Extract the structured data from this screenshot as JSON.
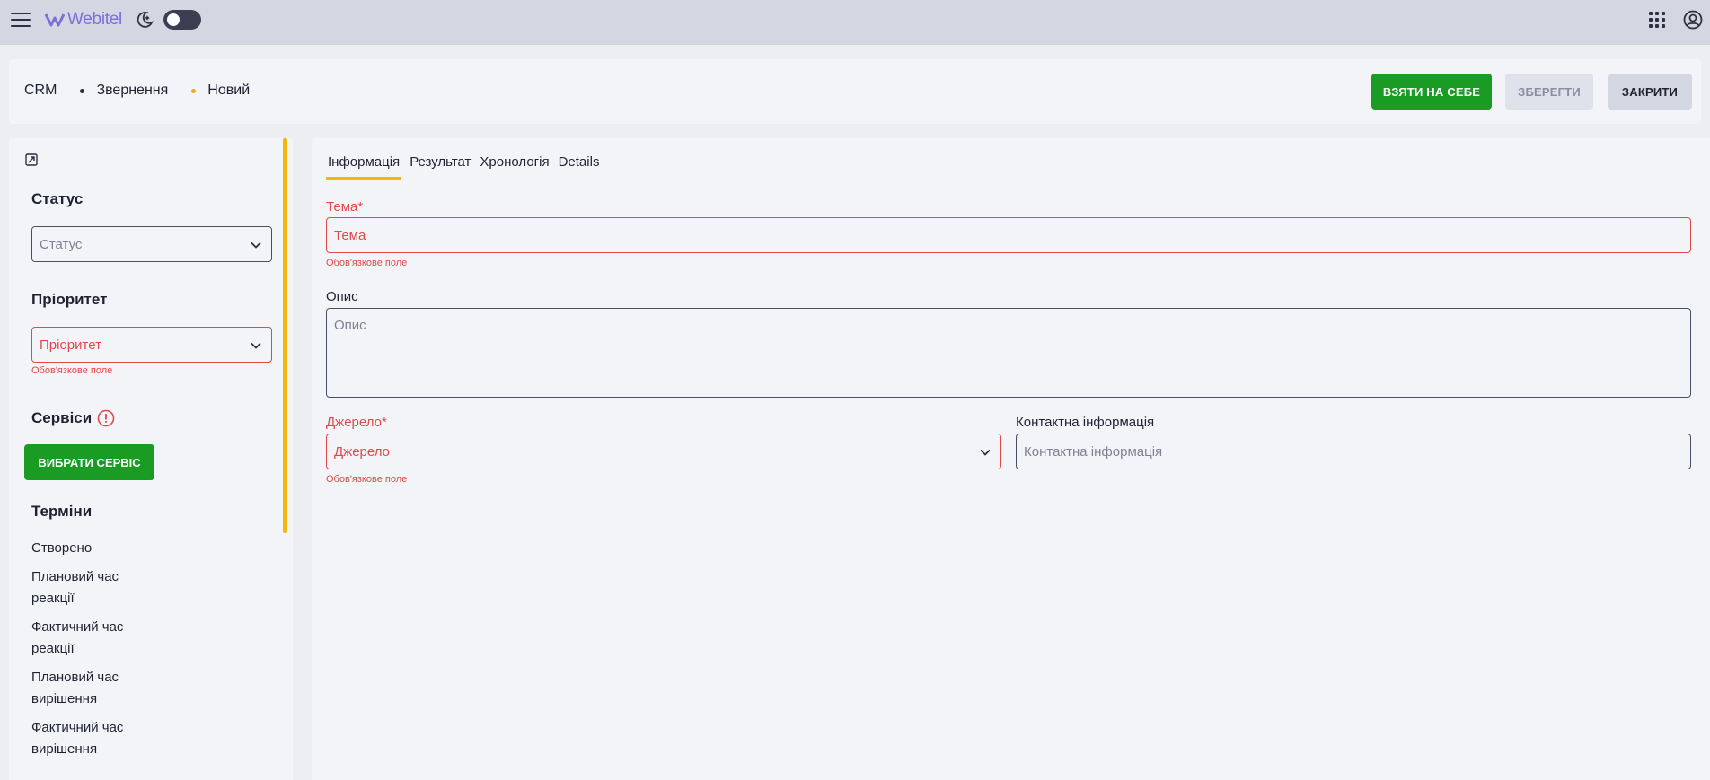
{
  "topbar": {
    "logo_text": "Webitel"
  },
  "header": {
    "breadcrumb": [
      "CRM",
      "Звернення",
      "Новий"
    ],
    "take_label": "ВЗЯТИ НА СЕБЕ",
    "save_label": "ЗБЕРЕГТИ",
    "close_label": "ЗАКРИТИ"
  },
  "sidebar": {
    "status_title": "Статус",
    "status_placeholder": "Статус",
    "priority_title": "Пріоритет",
    "priority_placeholder": "Пріоритет",
    "priority_error": "Обов'язкове поле",
    "services_title": "Сервіси",
    "select_service_label": "ВИБРАТИ СЕРВІС",
    "terms_title": "Терміни",
    "terms": [
      "Створено",
      "Плановий час реакції",
      "Фактичний час реакції",
      "Плановий час вирішення",
      "Фактичний час вирішення"
    ]
  },
  "main": {
    "tabs": [
      "Інформація",
      "Результат",
      "Хронологія",
      "Details"
    ],
    "active_tab": "Інформація",
    "subject_label": "Тема*",
    "subject_placeholder": "Тема",
    "subject_error": "Обов'язкове поле",
    "description_label": "Опис",
    "description_placeholder": "Опис",
    "source_label": "Джерело*",
    "source_placeholder": "Джерело",
    "source_error": "Обов'язкове поле",
    "contact_label": "Контактна інформація",
    "contact_placeholder": "Контактна інформація"
  },
  "colors": {
    "accent_green": "#1a9b24",
    "accent_yellow": "#f5b50b",
    "error_red": "#e04a4a",
    "brand_purple": "#7b6fd9"
  }
}
